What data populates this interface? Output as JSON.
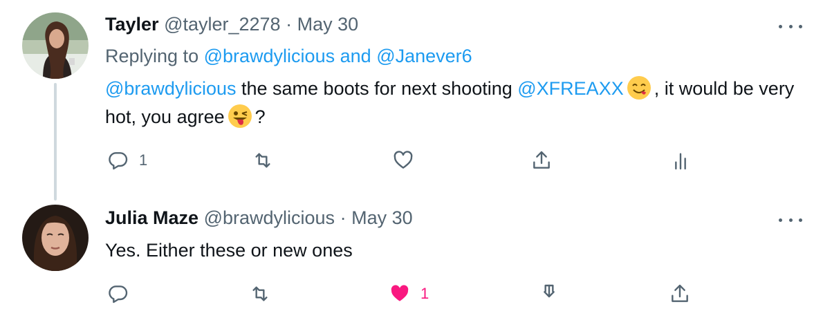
{
  "tweets": [
    {
      "name": "Tayler",
      "handle": "@tayler_2278",
      "separator": "·",
      "date": "May 30",
      "replying_prefix": "Replying to",
      "replying_user1": "@brawdylicious",
      "replying_and": "and",
      "replying_user2": "@Janever6",
      "text_mention1": "@brawdylicious",
      "text_part1": "the same boots for next shooting",
      "text_mention2": "@XFREAXX",
      "text_part2": ", it would be very hot, you agree",
      "text_part3": "?",
      "reply_count": "1",
      "icons": [
        "reply-icon",
        "retweet-icon",
        "like-icon",
        "share-icon",
        "analytics-icon"
      ]
    },
    {
      "name": "Julia Maze",
      "handle": "@brawdylicious",
      "separator": "·",
      "date": "May 30",
      "text": "Yes. Either these or new ones",
      "like_count": "1",
      "icons": [
        "reply-icon",
        "retweet-icon",
        "like-icon-filled",
        "download-icon",
        "share-icon"
      ]
    }
  ],
  "colors": {
    "text": "#0f1419",
    "secondary": "#536471",
    "link": "#1d9bf0",
    "like": "#f91880",
    "thread_line": "#cfd9de"
  }
}
